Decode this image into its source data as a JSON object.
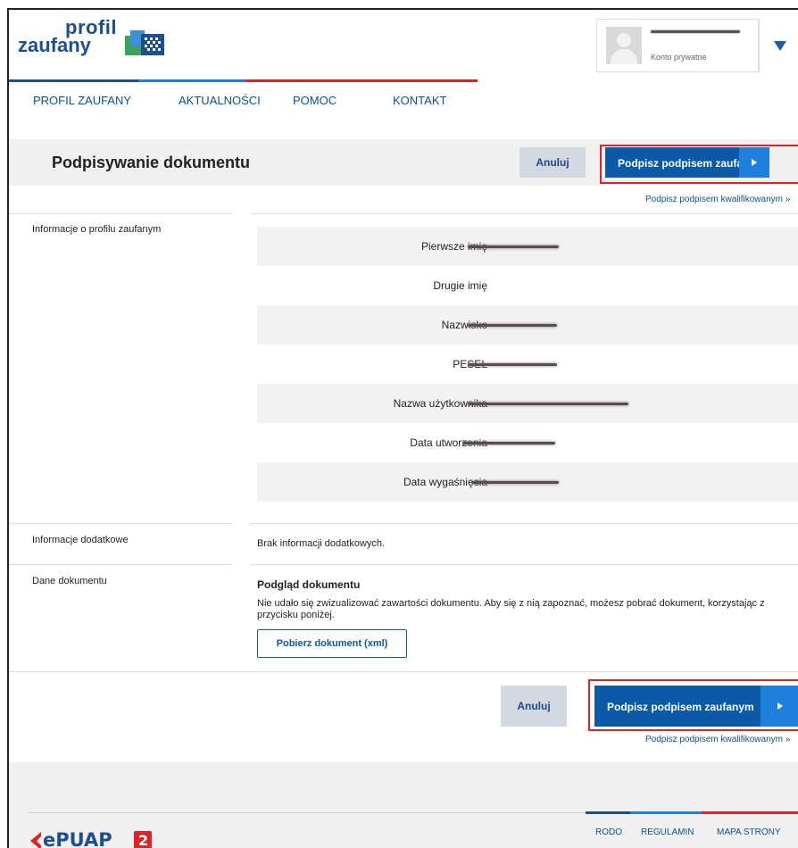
{
  "header": {
    "logo_line1": "profil",
    "logo_line2": "zaufany",
    "user_type": "Konto prywatne"
  },
  "nav": {
    "items": [
      "PROFIL ZAUFANY",
      "AKTUALNOŚCI",
      "POMOC",
      "KONTAKT"
    ]
  },
  "title_bar": {
    "title": "Podpisywanie dokumentu",
    "cancel_label": "Anuluj",
    "sign_label": "Podpisz podpisem zaufanym",
    "qualified_link": "Podpisz podpisem kwalifikowanym »"
  },
  "profile_info": {
    "section_label": "Informacje o profilu zaufanym",
    "fields": [
      {
        "label": "Pierwsze imię",
        "value_redacted": true
      },
      {
        "label": "Drugie imię",
        "value_redacted": false
      },
      {
        "label": "Nazwisko",
        "value_redacted": true
      },
      {
        "label": "PESEL",
        "value_redacted": true
      },
      {
        "label": "Nazwa użytkownika",
        "value_redacted": true
      },
      {
        "label": "Data utworzenia",
        "value_redacted": true
      },
      {
        "label": "Data wygaśnięcia",
        "value_redacted": true
      }
    ]
  },
  "additional_info": {
    "section_label": "Informacje dodatkowe",
    "text": "Brak informacji dodatkowych."
  },
  "document": {
    "section_label": "Dane dokumentu",
    "preview_title": "Podgląd dokumentu",
    "preview_text": "Nie udało się zwizualizować zawartości dokumentu. Aby się z nią zapoznać, możesz pobrać dokument, korzystając z przycisku poniżej.",
    "download_label": "Pobierz dokument (xml)"
  },
  "bottom_actions": {
    "cancel_label": "Anuluj",
    "sign_label": "Podpisz podpisem zaufanym",
    "qualified_link": "Podpisz podpisem kwalifikowanym »"
  },
  "footer": {
    "logo_text": "ePUAP",
    "logo_badge": "2",
    "links": [
      "RODO",
      "REGULAMIN",
      "MAPA STRONY"
    ]
  },
  "colors": {
    "brand_blue": "#0b5aa8",
    "accent_blue": "#1e7fdc",
    "nav_red": "#d9252a",
    "highlight_red": "#d9252a"
  }
}
